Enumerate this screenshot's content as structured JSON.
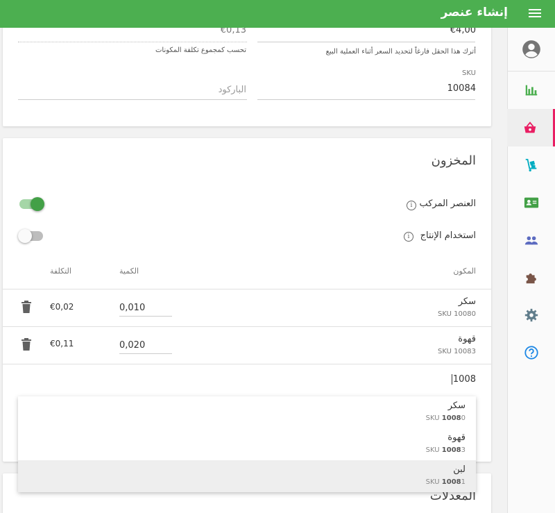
{
  "header": {
    "title": "إنشاء عنصر"
  },
  "card1": {
    "price_value": "€4,00",
    "price_hint": "أترك هذا الحقل فارغاً لتحديد السعر أثناء العملية البيع",
    "cost_value": "€0,13",
    "cost_hint": "تحسب كمجموع تكلفة المكونات",
    "sku_label": "SKU",
    "sku_value": "10084",
    "barcode_placeholder": "الباركود"
  },
  "inventory": {
    "title": "المخزون",
    "composite_label": "العنصر المركب",
    "composite_on": true,
    "production_label": "استخدام الإنتاج",
    "production_on": false,
    "info_symbol": "i",
    "col_component": "المكون",
    "col_quantity": "الكمية",
    "col_cost": "التكلفة",
    "rows": [
      {
        "name": "سكر",
        "sku": "SKU 10080",
        "qty": "0,010",
        "cost": "€0,02"
      },
      {
        "name": "قهوة",
        "sku": "SKU 10083",
        "qty": "0,020",
        "cost": "€0,11"
      }
    ],
    "search_value": "1008"
  },
  "dropdown": {
    "items": [
      {
        "name": "سكر",
        "sku_prefix": "SKU ",
        "sku_match": "1008",
        "sku_rest": "0"
      },
      {
        "name": "قهوة",
        "sku_prefix": "SKU ",
        "sku_match": "1008",
        "sku_rest": "3"
      },
      {
        "name": "لبن",
        "sku_prefix": "SKU ",
        "sku_match": "1008",
        "sku_rest": "1"
      }
    ]
  },
  "modifiers": {
    "title": "المعدلات"
  },
  "nav": {
    "icons": [
      "account-icon",
      "reports-icon",
      "items-icon",
      "inventory-icon",
      "customers-icon",
      "employees-icon",
      "integrations-icon",
      "settings-icon",
      "help-icon"
    ],
    "active": "items-icon",
    "colors": {
      "reports": "#4caf50",
      "items": "#e91e63",
      "inventory": "#00acc1",
      "customers": "#43a047",
      "employees": "#5c6bc0",
      "integrations": "#795548",
      "settings": "#607d8b",
      "help": "#1e88e5"
    }
  },
  "colors": {
    "accent": "#4caf50",
    "active_tab": "#e91e63"
  }
}
